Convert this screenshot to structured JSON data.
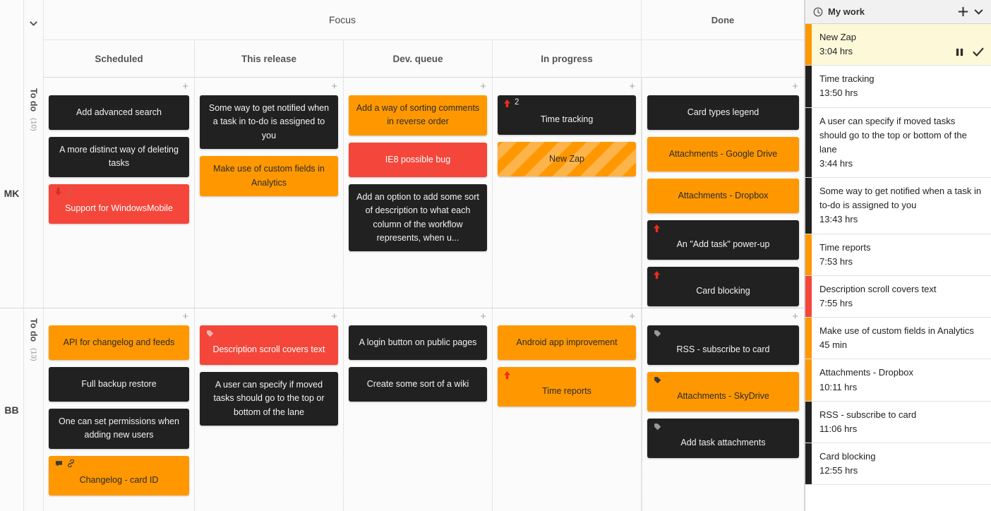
{
  "board": {
    "collapse_icon": "chevron-down-icon",
    "groups": [
      {
        "label": "",
        "key": "spacer"
      },
      {
        "label": "Focus",
        "key": "focus"
      },
      {
        "label": "Done",
        "key": "done"
      }
    ],
    "columns": [
      {
        "label": "Scheduled",
        "add_label": "+"
      },
      {
        "label": "This release",
        "add_label": "+"
      },
      {
        "label": "Dev. queue",
        "add_label": "+"
      },
      {
        "label": "In progress",
        "add_label": "+"
      },
      {
        "label": "",
        "add_label": "+"
      }
    ],
    "lanes": [
      {
        "avatar": "MK",
        "state": "To do",
        "count": "(10)",
        "columns": [
          {
            "cards": [
              {
                "title": "Add advanced search",
                "color": "dark",
                "icons": []
              },
              {
                "title": "A more distinct way of deleting tasks",
                "color": "dark",
                "icons": []
              },
              {
                "title": "Support for WindowsMobile",
                "color": "red",
                "icons": [
                  "arrow-down-icon",
                  "link-icon"
                ]
              }
            ]
          },
          {
            "cards": [
              {
                "title": "Some way to get notified when a task in to-do is assigned to you",
                "color": "dark",
                "icons": []
              },
              {
                "title": "Make use of custom fields in Analytics",
                "color": "orange",
                "icons": []
              }
            ]
          },
          {
            "cards": [
              {
                "title": "Add a way of sorting comments in reverse order",
                "color": "orange",
                "icons": []
              },
              {
                "title": "IE8 possible bug",
                "color": "red",
                "icons": []
              },
              {
                "title": "Add an option to add some sort of description to what each column of the workflow represents, when u...",
                "color": "dark",
                "icons": []
              }
            ]
          },
          {
            "cards": [
              {
                "title": "Time tracking",
                "color": "dark",
                "icons": [
                  "arrow-up-icon"
                ],
                "badge_count": "2"
              },
              {
                "title": "New Zap",
                "color": "striped",
                "icons": []
              }
            ]
          },
          {
            "cards": [
              {
                "title": "Card types legend",
                "color": "dark",
                "icons": []
              },
              {
                "title": "Attachments - Google Drive",
                "color": "orange",
                "icons": []
              },
              {
                "title": "Attachments - Dropbox",
                "color": "orange",
                "icons": []
              },
              {
                "title": "An \"Add task\" power-up",
                "color": "dark",
                "icons": [
                  "arrow-up-icon"
                ]
              },
              {
                "title": "Card blocking",
                "color": "dark",
                "icons": [
                  "arrow-up-icon"
                ]
              }
            ]
          }
        ]
      },
      {
        "avatar": "BB",
        "state": "To do",
        "count": "(13)",
        "columns": [
          {
            "cards": [
              {
                "title": "API for changelog and feeds",
                "color": "orange",
                "icons": []
              },
              {
                "title": "Full backup restore",
                "color": "dark",
                "icons": []
              },
              {
                "title": "One can set permissions when adding new users",
                "color": "dark",
                "icons": []
              },
              {
                "title": "Changelog - card ID",
                "color": "orange",
                "icons": [
                  "comment-icon",
                  "link-icon"
                ]
              }
            ]
          },
          {
            "cards": [
              {
                "title": "Description scroll covers text",
                "color": "red",
                "icons": [
                  "tag-icon"
                ]
              },
              {
                "title": "A user can specify if moved tasks should go to the top or bottom of the lane",
                "color": "dark",
                "icons": []
              }
            ]
          },
          {
            "cards": [
              {
                "title": "A login button on public pages",
                "color": "dark",
                "icons": []
              },
              {
                "title": "Create some sort of a wiki",
                "color": "dark",
                "icons": []
              }
            ]
          },
          {
            "cards": [
              {
                "title": "Android app improvement",
                "color": "orange",
                "icons": []
              },
              {
                "title": "Time reports",
                "color": "orange",
                "icons": [
                  "arrow-up-icon"
                ]
              }
            ]
          },
          {
            "cards": [
              {
                "title": "RSS - subscribe to card",
                "color": "dark",
                "icons": [
                  "tag-icon"
                ]
              },
              {
                "title": "Attachments - SkyDrive",
                "color": "orange",
                "icons": [
                  "tag-icon"
                ]
              },
              {
                "title": "Add task attachments",
                "color": "dark",
                "icons": [
                  "tag-icon"
                ]
              }
            ]
          }
        ]
      }
    ]
  },
  "sidebar": {
    "title": "My work",
    "clock_icon": "clock-icon",
    "add_icon": "plus-icon",
    "collapse_icon": "chevron-down-icon",
    "items": [
      {
        "name": "New Zap",
        "time": "3:04 hrs",
        "stripe": "#ff9800",
        "active": true,
        "actions": [
          "pause-icon",
          "check-icon"
        ]
      },
      {
        "name": "Time tracking",
        "time": "13:50 hrs",
        "stripe": "#212121",
        "active": false,
        "actions": []
      },
      {
        "name": "A user can specify if moved tasks should go to the top or bottom of the lane",
        "time": "3:44 hrs",
        "stripe": "#212121",
        "active": false,
        "actions": []
      },
      {
        "name": "Some way to get notified when a task in to-do is assigned to you",
        "time": "13:43 hrs",
        "stripe": "#212121",
        "active": false,
        "actions": []
      },
      {
        "name": "Time reports",
        "time": "7:53 hrs",
        "stripe": "#ff9800",
        "active": false,
        "actions": []
      },
      {
        "name": "Description scroll covers text",
        "time": "7:55 hrs",
        "stripe": "#f4463a",
        "active": false,
        "actions": []
      },
      {
        "name": "Make use of custom fields in Analytics",
        "time": "45 min",
        "stripe": "#ff9800",
        "active": false,
        "actions": []
      },
      {
        "name": "Attachments - Dropbox",
        "time": "10:11 hrs",
        "stripe": "#ff9800",
        "active": false,
        "actions": []
      },
      {
        "name": "RSS - subscribe to card",
        "time": "11:06 hrs",
        "stripe": "#212121",
        "active": false,
        "actions": []
      },
      {
        "name": "Card blocking",
        "time": "12:55 hrs",
        "stripe": "#212121",
        "active": false,
        "actions": []
      }
    ]
  },
  "colors": {
    "card_dark": "#212121",
    "card_orange": "#ff9800",
    "card_red": "#f4463a",
    "active_row": "#fcf8d8",
    "board_bg": "#fbfbfb"
  }
}
